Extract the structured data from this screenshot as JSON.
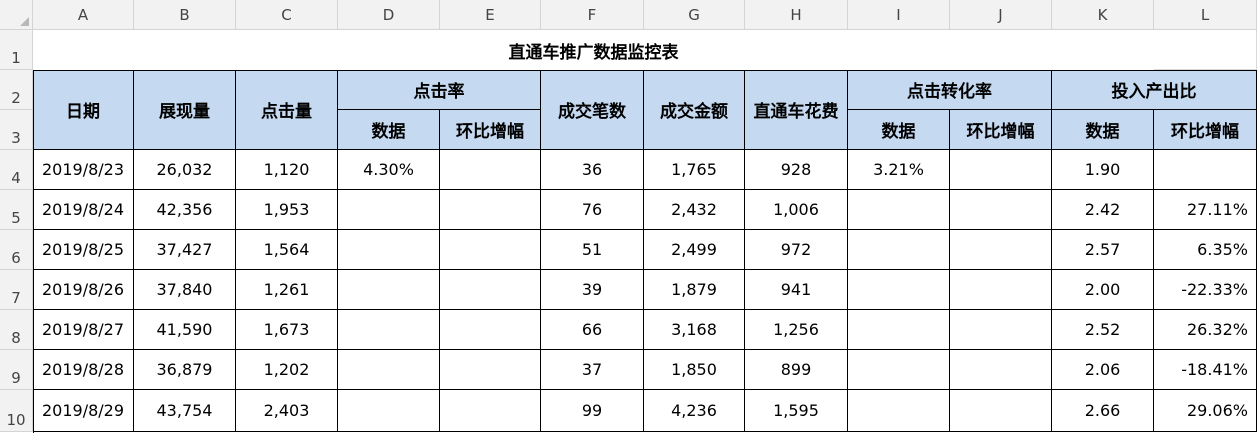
{
  "sheet": {
    "column_letters": [
      "A",
      "B",
      "C",
      "D",
      "E",
      "F",
      "G",
      "H",
      "I",
      "J",
      "K",
      "L"
    ],
    "row_numbers": [
      "1",
      "2",
      "3",
      "4",
      "5",
      "6",
      "7",
      "8",
      "9",
      "10"
    ],
    "title": "直通车推广数据监控表",
    "headers": {
      "date": "日期",
      "impressions": "展现量",
      "clicks": "点击量",
      "ctr_group": "点击率",
      "ctr_data": "数据",
      "ctr_change": "环比增幅",
      "orders": "成交笔数",
      "revenue": "成交金额",
      "spend": "直通车花费",
      "cvr_group": "点击转化率",
      "cvr_data": "数据",
      "cvr_change": "环比增幅",
      "roi_group": "投入产出比",
      "roi_data": "数据",
      "roi_change": "环比增幅"
    },
    "rows": [
      [
        "2019/8/23",
        "26,032",
        "1,120",
        "4.30%",
        "",
        "36",
        "1,765",
        "928",
        "3.21%",
        "",
        "1.90",
        ""
      ],
      [
        "2019/8/24",
        "42,356",
        "1,953",
        "",
        "",
        "76",
        "2,432",
        "1,006",
        "",
        "",
        "2.42",
        "27.11%"
      ],
      [
        "2019/8/25",
        "37,427",
        "1,564",
        "",
        "",
        "51",
        "2,499",
        "972",
        "",
        "",
        "2.57",
        "6.35%"
      ],
      [
        "2019/8/26",
        "37,840",
        "1,261",
        "",
        "",
        "39",
        "1,879",
        "941",
        "",
        "",
        "2.00",
        "-22.33%"
      ],
      [
        "2019/8/27",
        "41,590",
        "1,673",
        "",
        "",
        "66",
        "3,168",
        "1,256",
        "",
        "",
        "2.52",
        "26.32%"
      ],
      [
        "2019/8/28",
        "36,879",
        "1,202",
        "",
        "",
        "37",
        "1,850",
        "899",
        "",
        "",
        "2.06",
        "-18.41%"
      ],
      [
        "2019/8/29",
        "43,754",
        "2,403",
        "",
        "",
        "99",
        "4,236",
        "1,595",
        "",
        "",
        "2.66",
        "29.06%"
      ]
    ],
    "colors": {
      "header_fill": "#c5d9f1",
      "sheet_header_fill": "#f2f2f2",
      "gridline": "#d9d9d9",
      "border": "#000000"
    }
  }
}
